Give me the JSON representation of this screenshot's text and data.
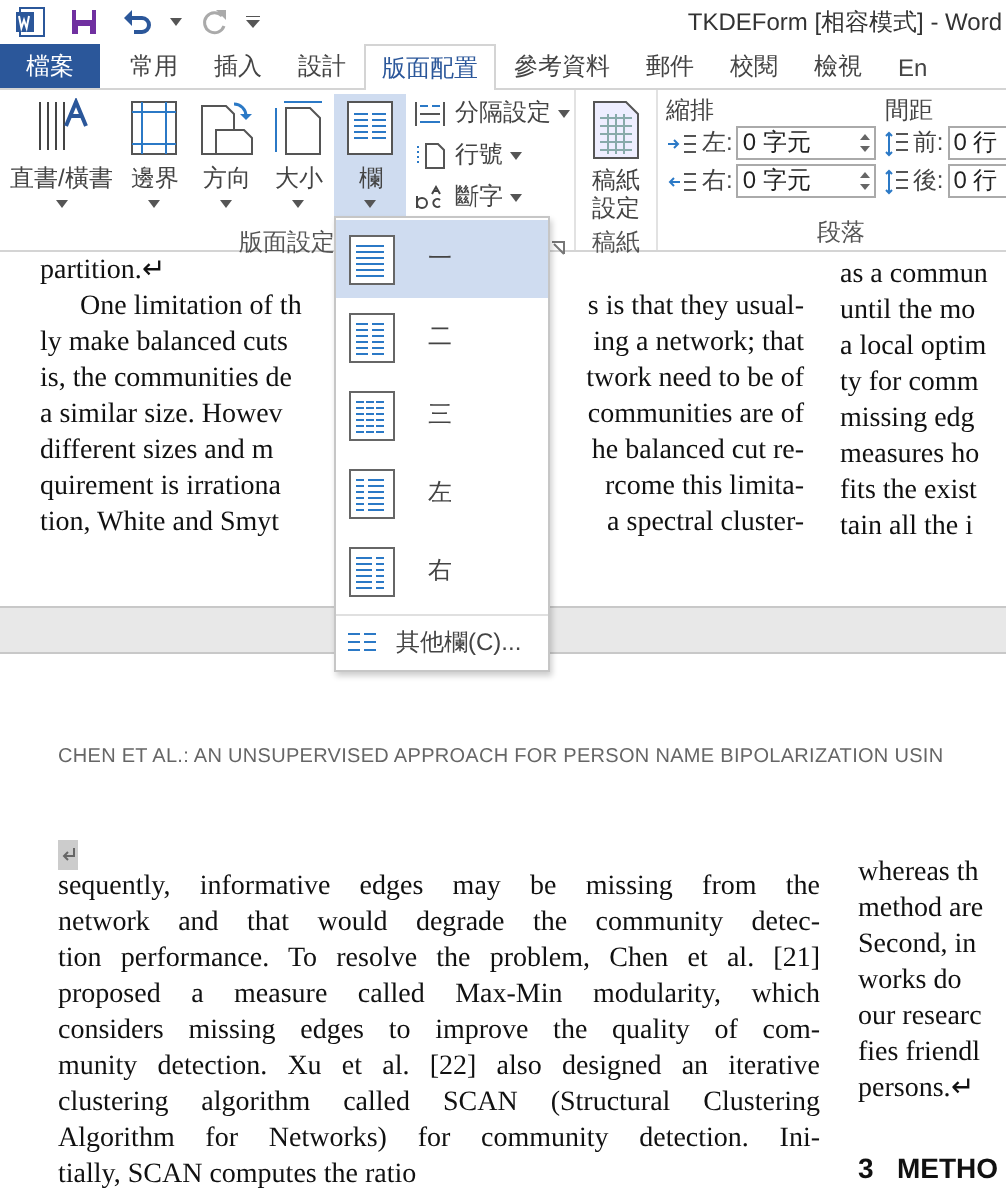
{
  "title_bar": {
    "title": "TKDEForm [相容模式] - Word"
  },
  "tabs": [
    {
      "label": "檔案",
      "kind": "file",
      "selected": false
    },
    {
      "label": "常用",
      "kind": "tab",
      "selected": false
    },
    {
      "label": "插入",
      "kind": "tab",
      "selected": false
    },
    {
      "label": "設計",
      "kind": "tab",
      "selected": false
    },
    {
      "label": "版面配置",
      "kind": "tab",
      "selected": true
    },
    {
      "label": "參考資料",
      "kind": "tab",
      "selected": false
    },
    {
      "label": "郵件",
      "kind": "tab",
      "selected": false
    },
    {
      "label": "校閱",
      "kind": "tab",
      "selected": false
    },
    {
      "label": "檢視",
      "kind": "tab",
      "selected": false
    },
    {
      "label": "En",
      "kind": "tab",
      "selected": false
    }
  ],
  "page_setup": {
    "buttons": [
      {
        "label": "直書/橫書",
        "kind": "direction",
        "pressed": false
      },
      {
        "label": "邊界",
        "kind": "margins",
        "pressed": false
      },
      {
        "label": "方向",
        "kind": "orientation",
        "pressed": false
      },
      {
        "label": "大小",
        "kind": "size",
        "pressed": false
      },
      {
        "label": "欄",
        "kind": "columns",
        "pressed": true
      }
    ],
    "small_buttons": [
      {
        "label": "分隔設定",
        "kind": "breaks"
      },
      {
        "label": "行號",
        "kind": "line-numbers"
      },
      {
        "label": "斷字",
        "kind": "hyphenation"
      }
    ],
    "group_label": "版面設定"
  },
  "manuscript": {
    "button": "稿紙設定",
    "group_label": "稿紙"
  },
  "paragraph": {
    "indent_label": "縮排",
    "spacing_label": "間距",
    "indent": [
      {
        "label": "左:",
        "value": "0 字元"
      },
      {
        "label": "右:",
        "value": "0 字元"
      }
    ],
    "spacing": [
      {
        "label": "前:",
        "value": "0 行"
      },
      {
        "label": "後:",
        "value": "0 行"
      }
    ],
    "group_label": "段落"
  },
  "columns_menu": {
    "items": [
      {
        "label": "一",
        "kind": "one",
        "selected": true
      },
      {
        "label": "二",
        "kind": "two",
        "selected": false
      },
      {
        "label": "三",
        "kind": "three",
        "selected": false
      },
      {
        "label": "左",
        "kind": "left",
        "selected": false
      },
      {
        "label": "右",
        "kind": "right",
        "selected": false
      }
    ],
    "more": "其他欄(C)..."
  },
  "page1": {
    "left_lines": [
      {
        "left": "partition.↵"
      },
      {
        "left": "One limitation of th",
        "right": "s is that they usual-"
      },
      {
        "left": "ly make balanced cuts",
        "right": "ing a network; that"
      },
      {
        "left": "is, the communities de",
        "right": "twork need to be of"
      },
      {
        "left": "a similar size. Howev",
        "right": "communities are of"
      },
      {
        "left": "different sizes and m",
        "right": "he balanced cut re-"
      },
      {
        "left": "quirement is irrationa",
        "right": "rcome this limita-"
      },
      {
        "left": "tion, White and Smyt",
        "right": "a spectral cluster-"
      }
    ],
    "right_lines": [
      "as a commun",
      "until the mo",
      "a local optim",
      "ty for comm",
      "missing edg",
      "measures ho",
      "fits the exist",
      "tain all the i"
    ]
  },
  "page2": {
    "header": "CHEN ET AL.:  AN UNSUPERVISED APPROACH FOR PERSON NAME BIPOLARIZATION USIN",
    "left_lines": [
      "sequently, informative edges may be missing from the",
      "network and that would degrade the community detec-",
      "tion performance. To resolve the problem, Chen et al. [21]",
      "proposed a measure called Max-Min modularity, which",
      "considers missing edges to improve the quality of com-",
      "munity detection. Xu et al. [22] also designed an iterative",
      "clustering algorithm called SCAN (Structural Clustering",
      "Algorithm for Networks) for community detection. Ini-",
      "tially, SCAN computes the ratio"
    ],
    "right_lines": [
      "whereas th",
      "method are",
      "Second,  in",
      "works do",
      "our researc",
      "fies  friendl",
      "persons.↵"
    ],
    "heading": "3   METHO"
  }
}
